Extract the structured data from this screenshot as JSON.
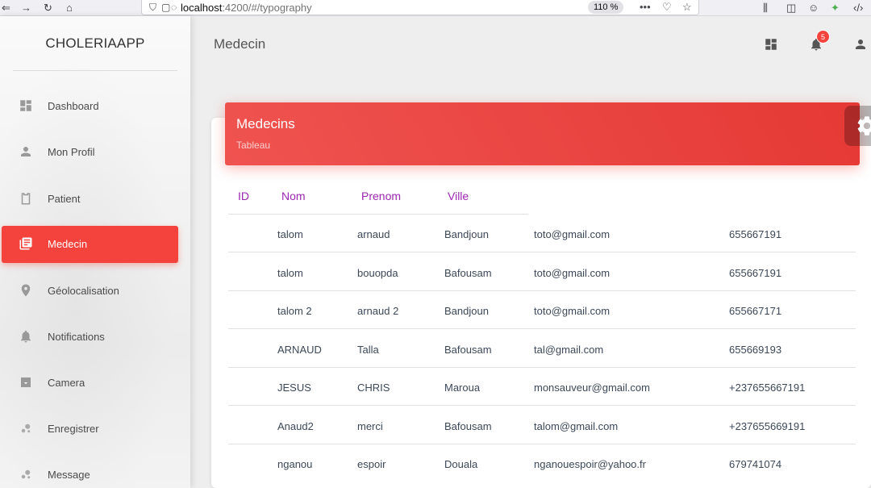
{
  "browser": {
    "url_host": "localhost",
    "url_path": ":4200/#/typography",
    "zoom": "110 %"
  },
  "sidebar": {
    "app_name": "CHOLERIAAPP",
    "items": [
      {
        "label": "Dashboard",
        "icon": "dashboard-icon",
        "active": false
      },
      {
        "label": "Mon Profil",
        "icon": "person-icon",
        "active": false
      },
      {
        "label": "Patient",
        "icon": "clipboard-icon",
        "active": false
      },
      {
        "label": "Medecin",
        "icon": "library-books-icon",
        "active": true
      },
      {
        "label": "Géolocalisation",
        "icon": "location-pin-icon",
        "active": false
      },
      {
        "label": "Notifications",
        "icon": "bell-icon",
        "active": false
      },
      {
        "label": "Camera",
        "icon": "camera-icon",
        "active": false
      },
      {
        "label": "Enregistrer",
        "icon": "bubble-icon",
        "active": false
      },
      {
        "label": "Message",
        "icon": "bubble-icon",
        "active": false
      }
    ]
  },
  "topbar": {
    "title": "Medecin",
    "notification_count": "5"
  },
  "card": {
    "title": "Medecins",
    "subtitle": "Tableau",
    "columns": [
      "ID",
      "Nom",
      "Prenom",
      "Ville"
    ],
    "rows": [
      {
        "id": "",
        "nom": "talom",
        "prenom": "arnaud",
        "ville": "Bandjoun",
        "email": "toto@gmail.com",
        "tel": "655667191"
      },
      {
        "id": "",
        "nom": "talom",
        "prenom": "bouopda",
        "ville": "Bafousam",
        "email": "toto@gmail.com",
        "tel": "655667191"
      },
      {
        "id": "",
        "nom": "talom 2",
        "prenom": "arnaud 2",
        "ville": "Bandjoun",
        "email": "toto@gmail.com",
        "tel": "655667171"
      },
      {
        "id": "",
        "nom": "ARNAUD",
        "prenom": "Talla",
        "ville": "Bafousam",
        "email": "tal@gmail.com",
        "tel": "655669193"
      },
      {
        "id": "",
        "nom": "JESUS",
        "prenom": "CHRIS",
        "ville": "Maroua",
        "email": "monsauveur@gmail.com",
        "tel": "+237655667191"
      },
      {
        "id": "",
        "nom": "Anaud2",
        "prenom": "merci",
        "ville": "Bafousam",
        "email": "talom@gmail.com",
        "tel": "+237655669191"
      },
      {
        "id": "",
        "nom": "nganou",
        "prenom": "espoir",
        "ville": "Douala",
        "email": "nganouespoir@yahoo.fr",
        "tel": "679741074"
      }
    ]
  },
  "colors": {
    "accent": "#f4433c",
    "header_purple": "#9c27b0"
  }
}
